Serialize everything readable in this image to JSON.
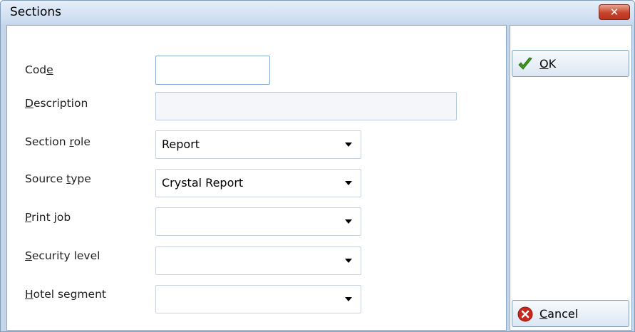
{
  "window": {
    "title": "Sections",
    "close_glyph": "✕"
  },
  "form": {
    "code": {
      "label_pre": "Cod",
      "label_acc": "e",
      "label_post": "",
      "value": ""
    },
    "description": {
      "label_pre": "",
      "label_acc": "D",
      "label_post": "escription",
      "value": ""
    },
    "section_role": {
      "label_pre": "Section ",
      "label_acc": "r",
      "label_post": "ole",
      "value": "Report"
    },
    "source_type": {
      "label_pre": "Source ",
      "label_acc": "t",
      "label_post": "ype",
      "value": "Crystal Report"
    },
    "print_job": {
      "label_pre": "",
      "label_acc": "P",
      "label_post": "rint job",
      "value": ""
    },
    "security_level": {
      "label_pre": "",
      "label_acc": "S",
      "label_post": "ecurity level",
      "value": ""
    },
    "hotel_segment": {
      "label_pre": "",
      "label_acc": "H",
      "label_post": "otel segment",
      "value": ""
    }
  },
  "buttons": {
    "ok": {
      "acc": "O",
      "post": "K",
      "icon": "green-checkmark-icon"
    },
    "cancel": {
      "acc": "C",
      "post": "ancel",
      "icon": "red-cancel-icon"
    }
  },
  "colors": {
    "titlebar": "#c8d9ee",
    "close": "#c8432b",
    "ok_icon": "#3f9b1b",
    "cancel_icon": "#c8271b"
  }
}
